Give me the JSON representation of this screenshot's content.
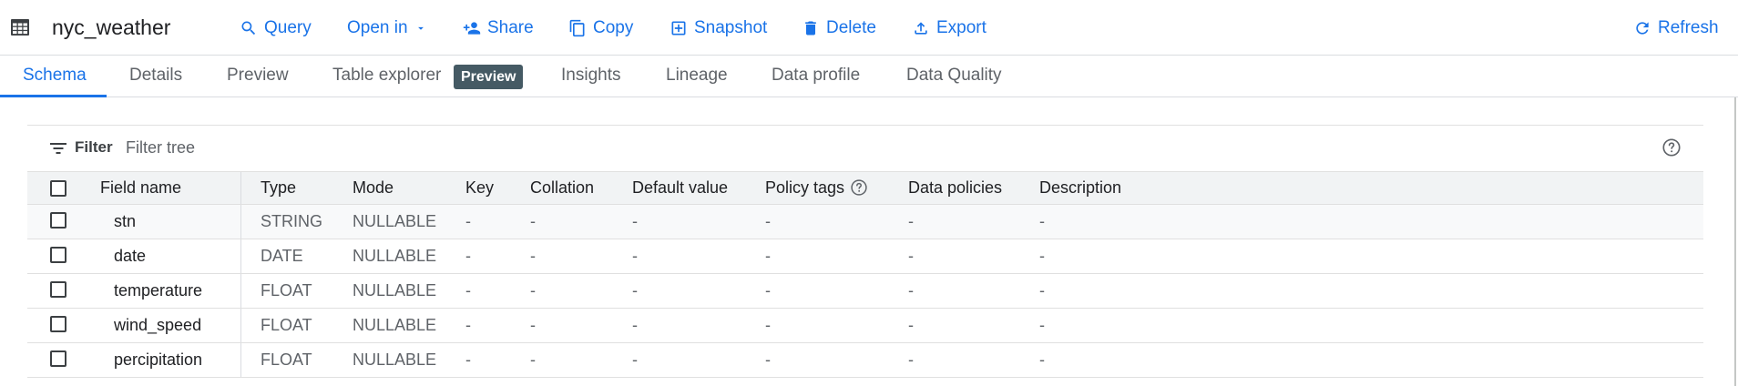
{
  "header": {
    "table_name": "nyc_weather",
    "actions": {
      "query": "Query",
      "open_in": "Open in",
      "share": "Share",
      "copy": "Copy",
      "snapshot": "Snapshot",
      "delete": "Delete",
      "export": "Export",
      "refresh": "Refresh"
    },
    "accent_color": "#1a73e8"
  },
  "tabs": [
    {
      "label": "Schema",
      "active": true
    },
    {
      "label": "Details"
    },
    {
      "label": "Preview"
    },
    {
      "label": "Table explorer",
      "badge": "Preview"
    },
    {
      "label": "Insights"
    },
    {
      "label": "Lineage"
    },
    {
      "label": "Data profile"
    },
    {
      "label": "Data Quality"
    }
  ],
  "filter": {
    "label": "Filter",
    "placeholder": "Filter tree"
  },
  "schema": {
    "columns": [
      "Field name",
      "Type",
      "Mode",
      "Key",
      "Collation",
      "Default value",
      "Policy tags",
      "Data policies",
      "Description"
    ],
    "rows": [
      {
        "name": "stn",
        "type": "STRING",
        "mode": "NULLABLE",
        "key": "-",
        "collation": "-",
        "default": "-",
        "policy_tags": "-",
        "data_policies": "-",
        "description": "-"
      },
      {
        "name": "date",
        "type": "DATE",
        "mode": "NULLABLE",
        "key": "-",
        "collation": "-",
        "default": "-",
        "policy_tags": "-",
        "data_policies": "-",
        "description": "-"
      },
      {
        "name": "temperature",
        "type": "FLOAT",
        "mode": "NULLABLE",
        "key": "-",
        "collation": "-",
        "default": "-",
        "policy_tags": "-",
        "data_policies": "-",
        "description": "-"
      },
      {
        "name": "wind_speed",
        "type": "FLOAT",
        "mode": "NULLABLE",
        "key": "-",
        "collation": "-",
        "default": "-",
        "policy_tags": "-",
        "data_policies": "-",
        "description": "-"
      },
      {
        "name": "percipitation",
        "type": "FLOAT",
        "mode": "NULLABLE",
        "key": "-",
        "collation": "-",
        "default": "-",
        "policy_tags": "-",
        "data_policies": "-",
        "description": "-"
      }
    ]
  }
}
